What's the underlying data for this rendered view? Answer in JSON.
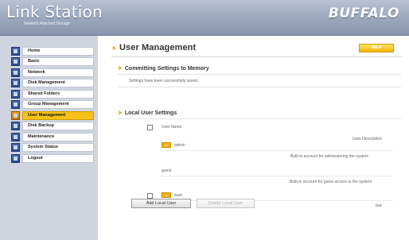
{
  "header": {
    "logo_text": "Link Station",
    "logo_subtext": "Network Attached Storage",
    "brand": "BUFFALO"
  },
  "sidebar": {
    "items": [
      {
        "label": "Home"
      },
      {
        "label": "Basic"
      },
      {
        "label": "Network"
      },
      {
        "label": "Disk Management"
      },
      {
        "label": "Shared Folders"
      },
      {
        "label": "Group Management"
      },
      {
        "label": "User Management"
      },
      {
        "label": "Disk Backup"
      },
      {
        "label": "Maintenance"
      },
      {
        "label": "System Status"
      },
      {
        "label": "Logout"
      }
    ],
    "active": "User Management"
  },
  "main": {
    "title": "User Management",
    "help_label": "HELP",
    "commit": {
      "heading": "Committing Settings to Memory",
      "message": "Settings have been successfully saved."
    },
    "local_users": {
      "heading": "Local User Settings",
      "col_user_name": "User Name",
      "col_user_description": "User Description",
      "users": [
        {
          "name": "admin",
          "description": "Built-in account for administering the system",
          "has_checkbox": false
        },
        {
          "name": "guest",
          "description": "Built-in account for guest access to the system",
          "has_checkbox": false
        },
        {
          "name": "iwan",
          "description": "iwa",
          "has_checkbox": true
        }
      ],
      "add_button": "Add Local User",
      "delete_button": "Delete Local User"
    }
  }
}
